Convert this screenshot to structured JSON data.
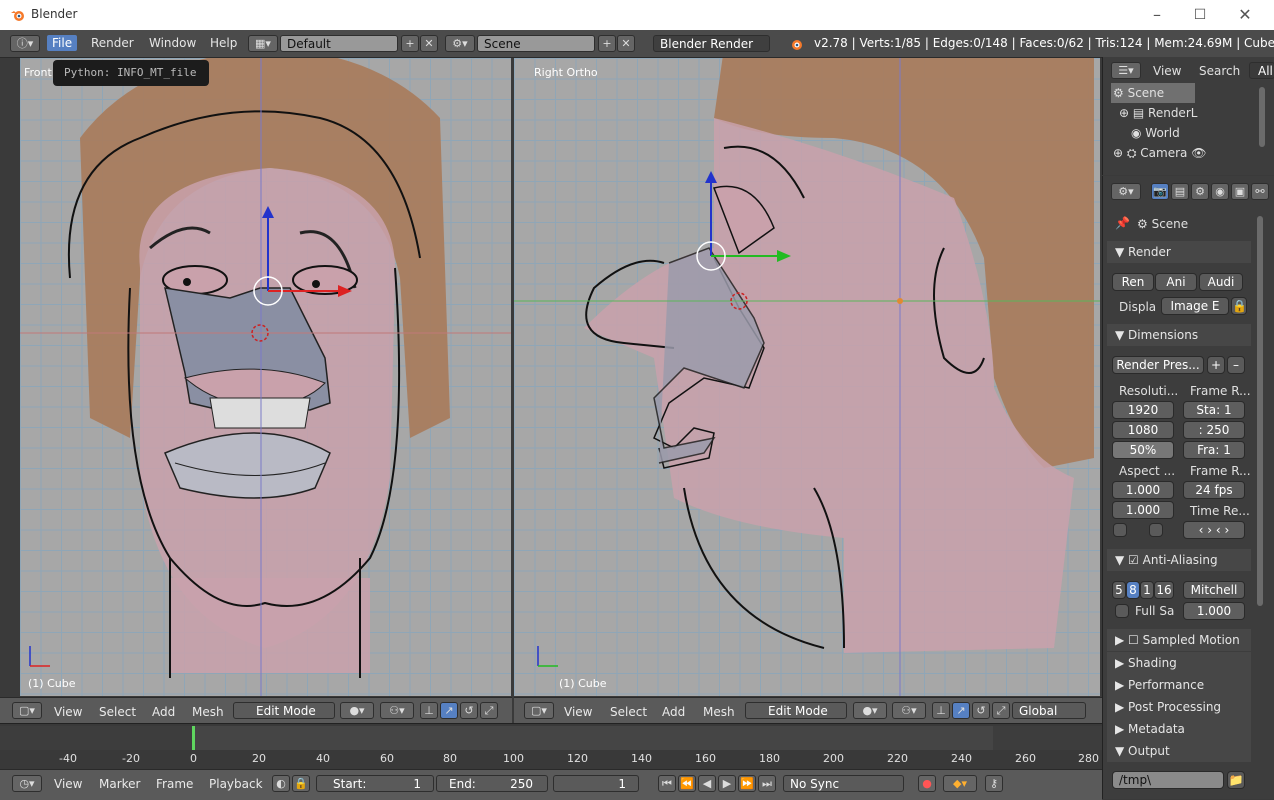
{
  "window": {
    "title": "Blender"
  },
  "info_header": {
    "menus": [
      "File",
      "Render",
      "Window",
      "Help"
    ],
    "screen_layout": "Default",
    "scene": "Scene",
    "render_engine": "Blender Render",
    "stats": "v2.78 | Verts:1/85 | Edges:0/148 | Faces:0/62 | Tris:124 | Mem:24.69M | Cube"
  },
  "tooltip": "Python: INFO_MT_file",
  "viewport_left": {
    "label": "Front",
    "object": "(1) Cube"
  },
  "viewport_right": {
    "label": "Right Ortho",
    "object": "(1) Cube"
  },
  "view3d_header": {
    "menus": [
      "View",
      "Select",
      "Add",
      "Mesh"
    ],
    "mode": "Edit Mode",
    "orientation": "Global"
  },
  "timeline": {
    "ticks": [
      "-40",
      "-20",
      "0",
      "20",
      "40",
      "60",
      "80",
      "100",
      "120",
      "140",
      "160",
      "180",
      "200",
      "220",
      "240",
      "260",
      "280"
    ],
    "menus": [
      "View",
      "Marker",
      "Frame",
      "Playback"
    ],
    "start_label": "Start:",
    "start_value": "1",
    "end_label": "End:",
    "end_value": "250",
    "current_frame": "1",
    "sync": "No Sync"
  },
  "outliner": {
    "menus": [
      "View",
      "Search",
      "All"
    ],
    "items": [
      "Scene",
      "RenderL",
      "World",
      "Camera"
    ]
  },
  "properties": {
    "context": "Scene",
    "render_panel": "Render",
    "render_buttons": [
      "Ren",
      "Ani",
      "Audi"
    ],
    "display_label": "Displa",
    "display_value": "Image E",
    "dimensions_panel": "Dimensions",
    "render_presets": "Render Pres...",
    "resolution_label": "Resoluti...",
    "frame_range_label": "Frame R...",
    "res_x": "1920",
    "res_y": "1080",
    "res_pct": "50%",
    "frame_start": "Sta: 1",
    "frame_end": ": 250",
    "frame_step": "Fra: 1",
    "aspect_label": "Aspect ...",
    "frame_rate_label": "Frame R...",
    "aspect_x": "1.000",
    "aspect_y": "1.000",
    "fps": "24 fps",
    "time_remap_label": "Time Re...",
    "aa_panel": "Anti-Aliasing",
    "aa_samples": [
      "5",
      "8",
      "1",
      "16"
    ],
    "aa_filter": "Mitchell",
    "full_sample": "Full Sa",
    "filter_size": "1.000",
    "collapsed_panels": [
      "Sampled Motion Bl",
      "Shading",
      "Performance",
      "Post Processing",
      "Metadata"
    ],
    "output_panel": "Output",
    "output_path": "/tmp\\"
  },
  "colors": {
    "accent": "#5680c2",
    "skin": "#c9a1ab",
    "hair": "#a97b5b",
    "grid": "#8fa6b7"
  }
}
